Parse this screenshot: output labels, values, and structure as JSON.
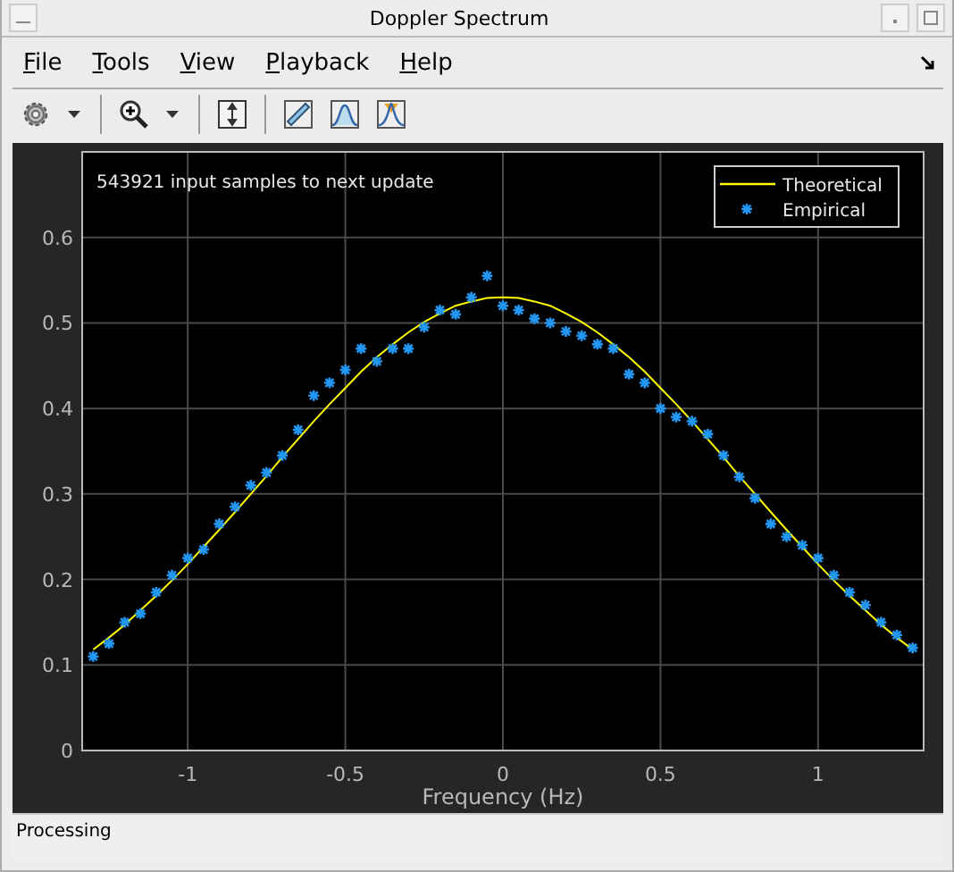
{
  "window": {
    "title": "Doppler Spectrum"
  },
  "menu": [
    "File",
    "Tools",
    "View",
    "Playback",
    "Help"
  ],
  "plot": {
    "chart_data": {
      "type": "line",
      "xlabel": "Frequency (Hz)",
      "xlim": [
        -1.335,
        1.335
      ],
      "ylim": [
        0,
        0.7
      ],
      "xticks": [
        -1,
        -0.5,
        0,
        0.5,
        1
      ],
      "yticks": [
        0,
        0.1,
        0.2,
        0.3,
        0.4,
        0.5,
        0.6
      ],
      "x": [
        -1.3,
        -1.25,
        -1.2,
        -1.15,
        -1.1,
        -1.05,
        -1,
        -0.95,
        -0.9,
        -0.85,
        -0.8,
        -0.75,
        -0.7,
        -0.65,
        -0.6,
        -0.55,
        -0.5,
        -0.45,
        -0.4,
        -0.35,
        -0.3,
        -0.25,
        -0.2,
        -0.15,
        -0.1,
        -0.05,
        0,
        0.05,
        0.1,
        0.15,
        0.2,
        0.25,
        0.3,
        0.35,
        0.4,
        0.45,
        0.5,
        0.55,
        0.6,
        0.65,
        0.7,
        0.75,
        0.8,
        0.85,
        0.9,
        0.95,
        1,
        1.05,
        1.1,
        1.15,
        1.2,
        1.25,
        1.3
      ],
      "series": [
        {
          "name": "Theoretical",
          "type": "line",
          "color": "#ffff00",
          "values": [
            0.118,
            0.132,
            0.147,
            0.164,
            0.181,
            0.199,
            0.218,
            0.238,
            0.258,
            0.279,
            0.3,
            0.321,
            0.343,
            0.364,
            0.385,
            0.405,
            0.424,
            0.443,
            0.46,
            0.475,
            0.489,
            0.501,
            0.511,
            0.52,
            0.525,
            0.529,
            0.53,
            0.529,
            0.525,
            0.52,
            0.511,
            0.501,
            0.489,
            0.475,
            0.46,
            0.443,
            0.424,
            0.405,
            0.385,
            0.364,
            0.343,
            0.321,
            0.3,
            0.279,
            0.258,
            0.238,
            0.218,
            0.199,
            0.181,
            0.164,
            0.147,
            0.132,
            0.118
          ]
        },
        {
          "name": "Empirical",
          "type": "scatter",
          "color": "#2196f3",
          "values": [
            0.11,
            0.125,
            0.15,
            0.16,
            0.185,
            0.205,
            0.225,
            0.235,
            0.265,
            0.285,
            0.31,
            0.325,
            0.345,
            0.375,
            0.415,
            0.43,
            0.445,
            0.47,
            0.455,
            0.47,
            0.47,
            0.495,
            0.515,
            0.51,
            0.53,
            0.555,
            0.52,
            0.515,
            0.505,
            0.5,
            0.49,
            0.485,
            0.475,
            0.47,
            0.44,
            0.43,
            0.4,
            0.39,
            0.385,
            0.37,
            0.345,
            0.32,
            0.295,
            0.265,
            0.25,
            0.24,
            0.225,
            0.205,
            0.185,
            0.17,
            0.15,
            0.135,
            0.12
          ]
        }
      ],
      "grid": true,
      "legend": true,
      "annotations": [
        {
          "text": "543921 input samples to next update"
        }
      ]
    }
  },
  "status_bar": "Processing"
}
